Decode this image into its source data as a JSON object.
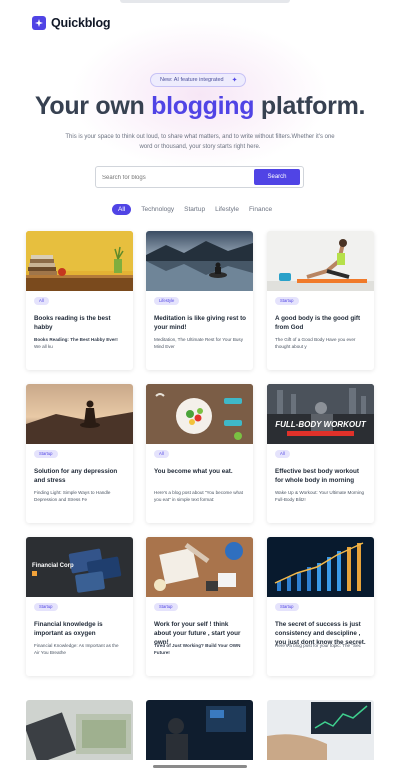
{
  "brand": {
    "name": "Quickblog"
  },
  "hero": {
    "badge": "New: AI feature integrated",
    "title_pre": "Your own",
    "title_accent": "blogging",
    "title_post": "platform.",
    "subtitle": "This is your space to think out loud, to share what matters, and to write without filters.Whether it's one word or thousand, your story starts right here."
  },
  "search": {
    "placeholder": "Search for blogs",
    "button": "Search"
  },
  "filters": [
    "All",
    "Technology",
    "Startup",
    "Lifestyle",
    "Finance"
  ],
  "colors": {
    "accent": "#5044e5",
    "tag_bg": "#e5e3fc",
    "text": "#1f2937"
  },
  "cards": [
    {
      "tag": "All",
      "title": "Books reading is the best habby",
      "desc_bold": "Books Reading: The Best Habby Ever!",
      "desc": "We all ku"
    },
    {
      "tag": "Lifestyle",
      "title": "Meditation is like giving rest to your mind!",
      "desc_bold": "",
      "desc": "Meditation, The Ultimate Rest for Your Busy Mind Ever"
    },
    {
      "tag": "Startup",
      "title": "A good body is the good gift from God",
      "desc_bold": "",
      "desc": "The Gift of a Good Body Have you ever thought about y"
    },
    {
      "tag": "Startup",
      "title": "Solution for any depression and stress",
      "desc_bold": "",
      "desc": "Finding Light: Simple Ways to Handle Depression and Stress Fe"
    },
    {
      "tag": "All",
      "title": "You become what you eat.",
      "desc_bold": "",
      "desc": "Here's a blog post about \"You become what you eat\" in simple text format:"
    },
    {
      "tag": "All",
      "title": "Effective best body workout for whole body in morning",
      "desc_bold": "",
      "desc": "Wake Up & Workout: Your Ultimate Morning Full-Body Blitz!"
    },
    {
      "tag": "Startup",
      "title": "Financial knowledge is important as oxygen",
      "desc_bold": "",
      "desc": "Financial Knowledge: As Important as the Air You Breathe"
    },
    {
      "tag": "Startup",
      "title": "Work for your self ! think about your future , start your own!",
      "desc_bold": "Tired of Just Working? Build Your OWN Future!",
      "desc": ""
    },
    {
      "tag": "Startup",
      "title": "The secret of success is just consistency and descipline , you just dont know the secret.",
      "desc_bold": "",
      "desc": "Here's a blog post for your topic: The \"Sec"
    }
  ],
  "thumb_texts": {
    "workout": "FULL-BODY WORKOUT",
    "finance": "Financial Corp"
  }
}
